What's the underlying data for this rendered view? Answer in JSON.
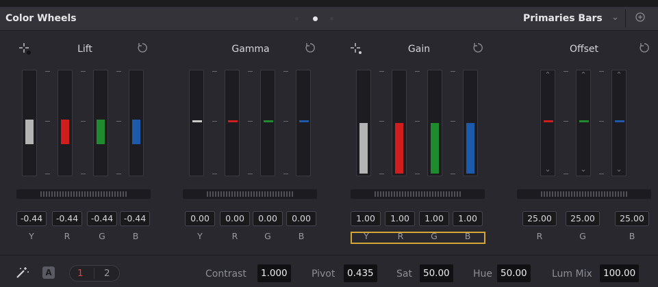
{
  "header": {
    "title": "Color Wheels",
    "mode": "Primaries Bars",
    "mode_chevron": "chevron-down-icon",
    "pager": {
      "pages": 3,
      "active": 2
    }
  },
  "panels": {
    "lift": {
      "title": "Lift",
      "values": [
        "-0.44",
        "-0.44",
        "-0.44",
        "-0.44"
      ],
      "channels": [
        "Y",
        "R",
        "G",
        "B"
      ]
    },
    "gamma": {
      "title": "Gamma",
      "values": [
        "0.00",
        "0.00",
        "0.00",
        "0.00"
      ],
      "channels": [
        "Y",
        "R",
        "G",
        "B"
      ]
    },
    "gain": {
      "title": "Gain",
      "values": [
        "1.00",
        "1.00",
        "1.00",
        "1.00"
      ],
      "channels": [
        "Y",
        "R",
        "G",
        "B"
      ]
    },
    "offset": {
      "title": "Offset",
      "values": [
        "25.00",
        "25.00",
        "25.00"
      ],
      "channels": [
        "R",
        "G",
        "B"
      ]
    }
  },
  "bar_colors": {
    "Y": "#b4b4b4",
    "R": "#d01e1e",
    "G": "#1e8c2e",
    "B": "#1e5aaa"
  },
  "footer": {
    "badge": "A",
    "page1": "1",
    "page2": "2",
    "contrast_label": "Contrast",
    "contrast_value": "1.000",
    "pivot_label": "Pivot",
    "pivot_value": "0.435",
    "sat_label": "Sat",
    "sat_value": "50.00",
    "hue_label": "Hue",
    "hue_value": "50.00",
    "lummix_label": "Lum Mix",
    "lummix_value": "100.00"
  }
}
